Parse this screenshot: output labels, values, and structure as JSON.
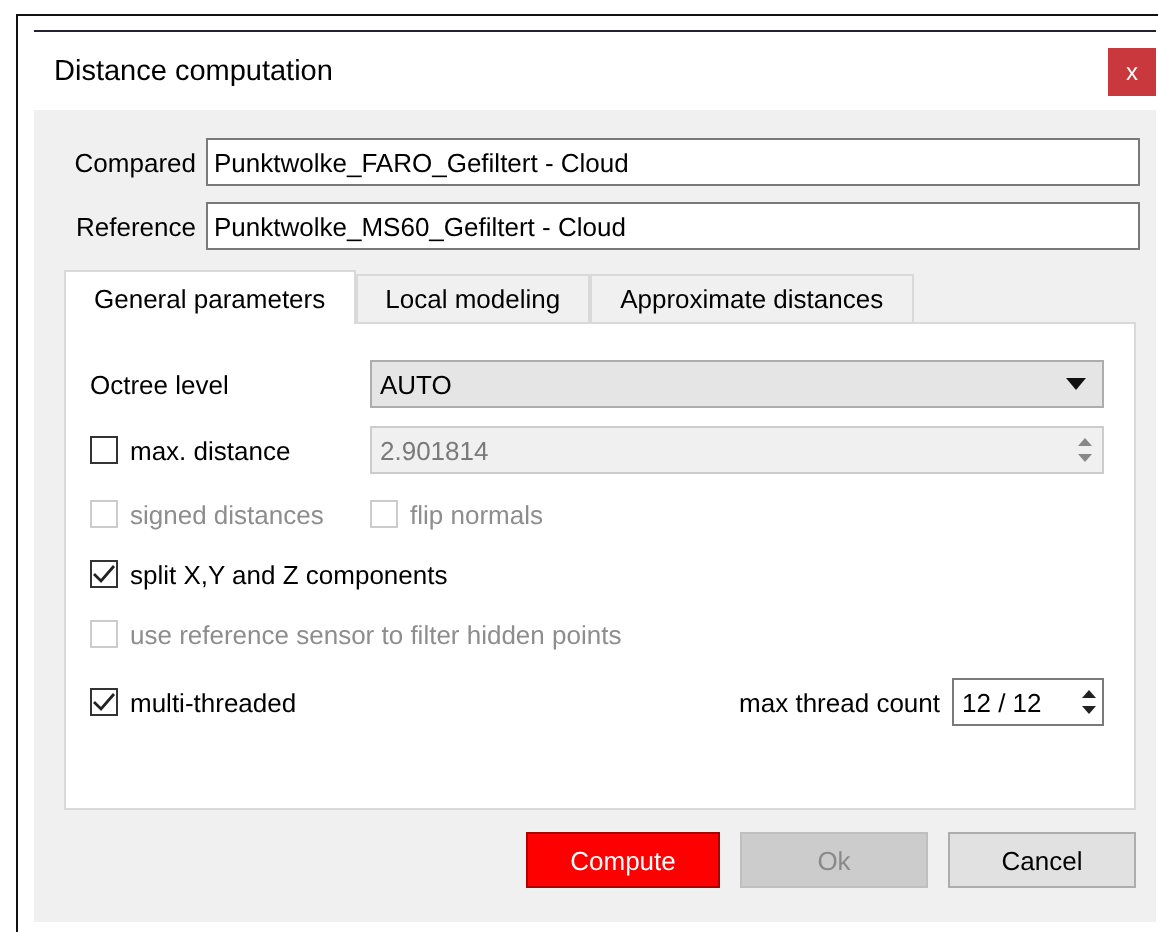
{
  "window": {
    "title": "Distance computation",
    "close": "x"
  },
  "compared": {
    "label": "Compared",
    "value": "Punktwolke_FARO_Gefiltert - Cloud"
  },
  "reference": {
    "label": "Reference",
    "value": "Punktwolke_MS60_Gefiltert - Cloud"
  },
  "tabs": [
    {
      "label": "General parameters",
      "selected": true
    },
    {
      "label": "Local modeling",
      "selected": false
    },
    {
      "label": "Approximate distances",
      "selected": false
    }
  ],
  "octree": {
    "label": "Octree level",
    "value": "AUTO"
  },
  "options": [
    {
      "kind": "check_field",
      "label": "max. distance",
      "checked": false,
      "disabled": false,
      "value": "2.901814",
      "field_disabled": true
    },
    {
      "kind": "check_row",
      "checks": [
        {
          "label": "signed distances",
          "checked": false,
          "disabled": true
        },
        {
          "label": "flip normals",
          "checked": false,
          "disabled": true
        }
      ]
    },
    {
      "kind": "check",
      "label": "split X,Y and Z components",
      "checked": true,
      "disabled": false
    },
    {
      "kind": "check",
      "label": "use reference sensor to filter hidden points",
      "checked": false,
      "disabled": true
    },
    {
      "kind": "check_spin",
      "label": "multi-threaded",
      "checked": true,
      "disabled": false,
      "spin_label": "max thread count",
      "spin_value": "12 / 12"
    }
  ],
  "buttons": [
    {
      "label": "Compute",
      "kind": "primary",
      "disabled": false
    },
    {
      "label": "Ok",
      "kind": "normal",
      "disabled": true
    },
    {
      "label": "Cancel",
      "kind": "normal",
      "disabled": false
    }
  ]
}
